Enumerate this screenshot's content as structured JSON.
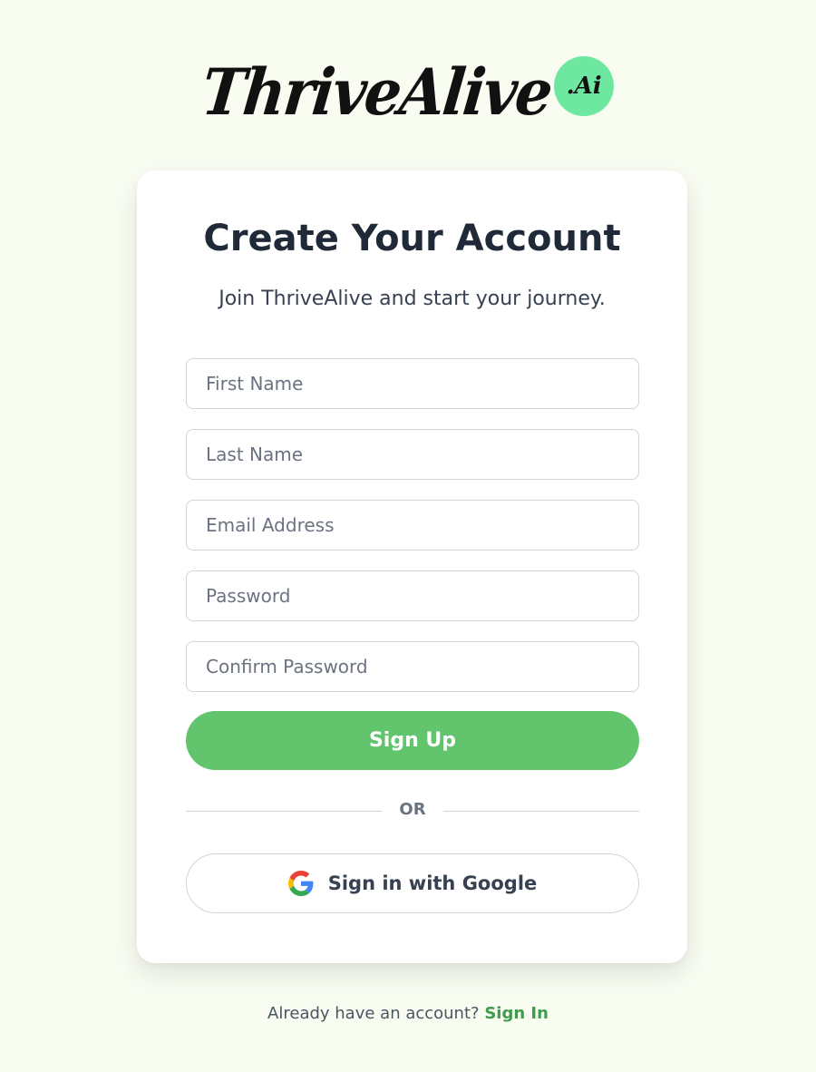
{
  "brand": {
    "wordmark": "ThriveAlive",
    "badge": ".Ai",
    "badge_color": "#6ee7a0"
  },
  "form": {
    "title": "Create Your Account",
    "subtitle": "Join ThriveAlive and start your journey.",
    "fields": {
      "first_name": {
        "placeholder": "First Name",
        "value": ""
      },
      "last_name": {
        "placeholder": "Last Name",
        "value": ""
      },
      "email": {
        "placeholder": "Email Address",
        "value": ""
      },
      "password": {
        "placeholder": "Password",
        "value": ""
      },
      "confirm_password": {
        "placeholder": "Confirm Password",
        "value": ""
      }
    },
    "signup_label": "Sign Up",
    "divider_label": "OR",
    "google_label": "Sign in with Google",
    "google_icon": "google-icon"
  },
  "footer": {
    "prompt": "Already have an account?",
    "signin_label": "Sign In"
  },
  "colors": {
    "page_background": "#f8fcf1",
    "primary_button": "#62c46d",
    "link": "#3f9c4d",
    "heading": "#1f2937"
  }
}
